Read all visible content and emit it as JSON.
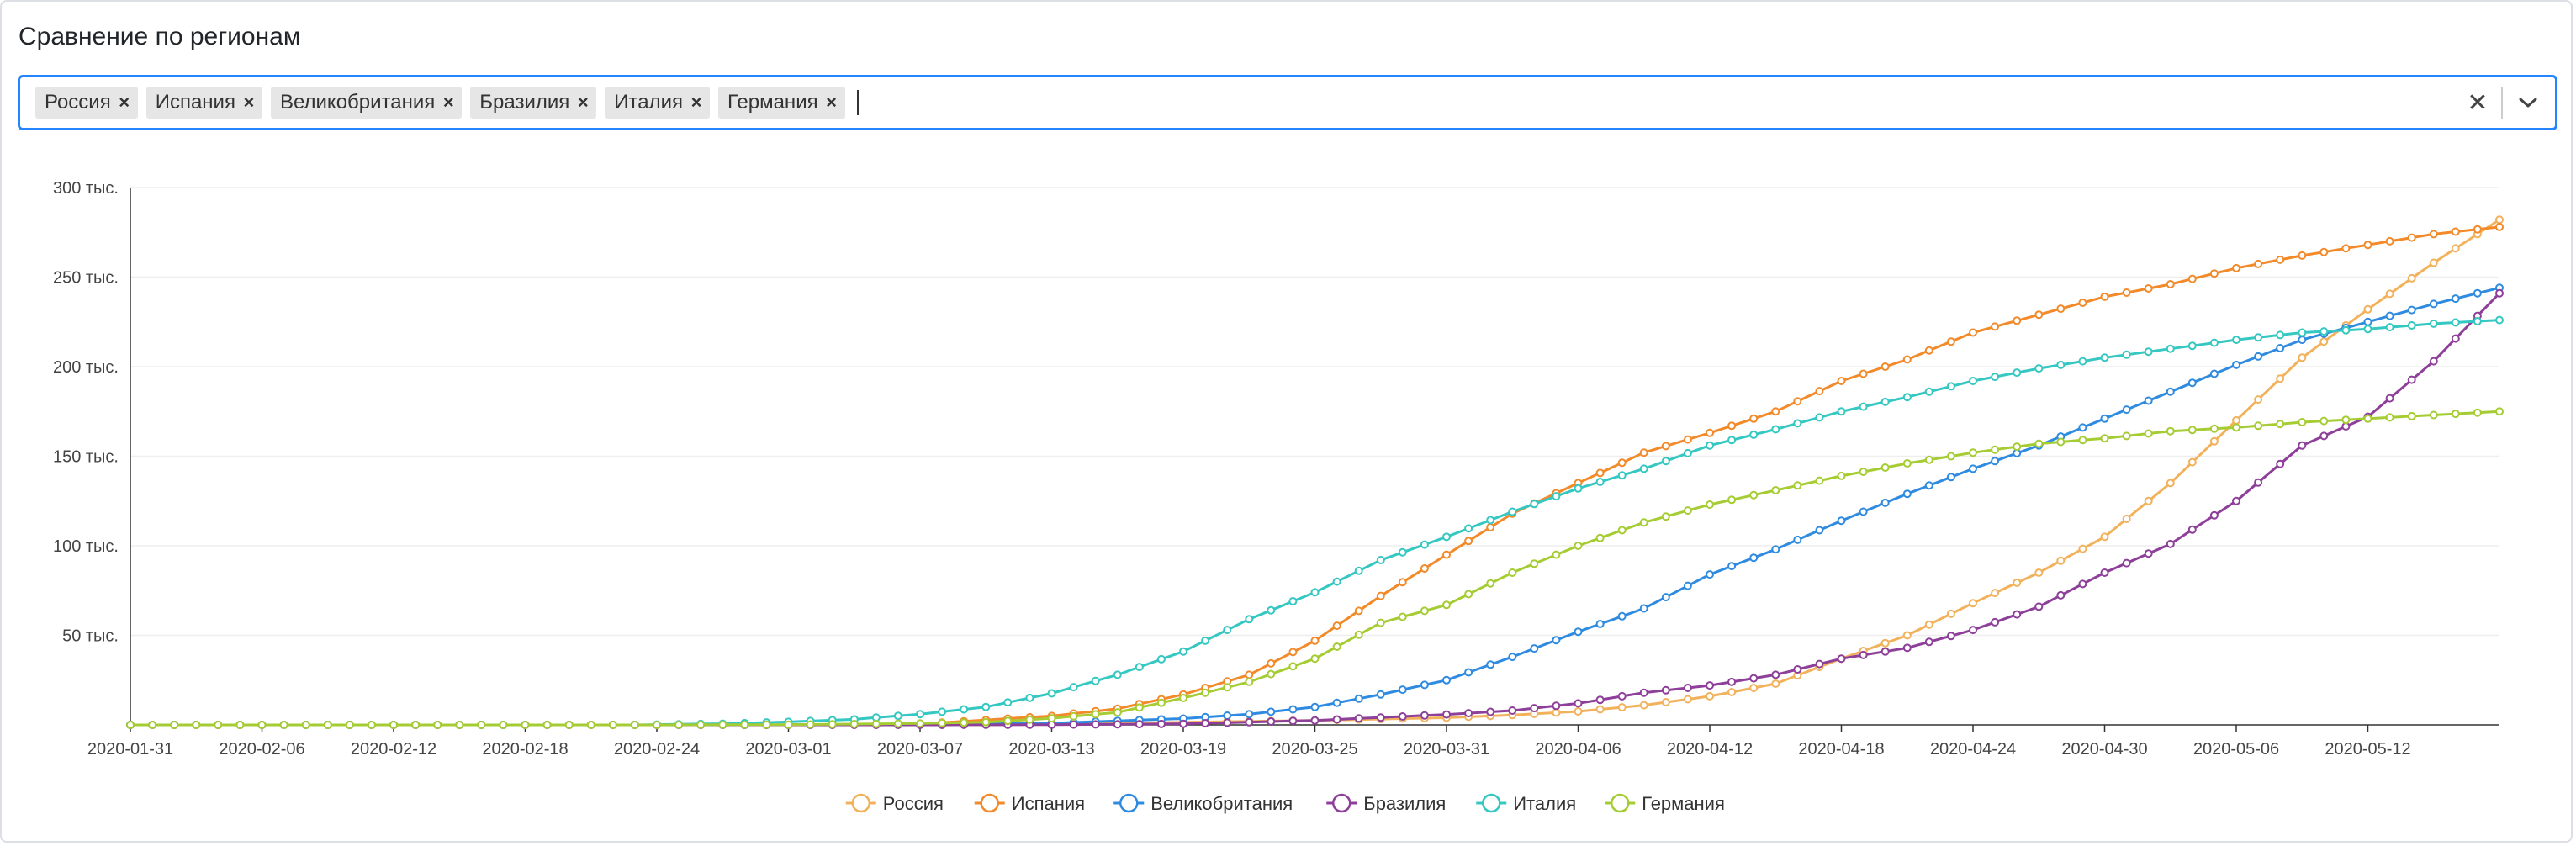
{
  "header": {
    "title": "Сравнение по регионам"
  },
  "selector": {
    "tags": [
      {
        "label": "Россия"
      },
      {
        "label": "Испания"
      },
      {
        "label": "Великобритания"
      },
      {
        "label": "Бразилия"
      },
      {
        "label": "Италия"
      },
      {
        "label": "Германия"
      }
    ],
    "remove_glyph": "×",
    "clear_glyph": "✕",
    "icons": {
      "clear": "close-icon",
      "dropdown": "chevron-down-icon",
      "tag_remove": "close-icon"
    }
  },
  "chart_data": {
    "type": "line",
    "title": "",
    "xlabel": "",
    "ylabel": "",
    "x_start": "2020-01-31",
    "x_end": "2020-05-18",
    "xticks": [
      "2020-01-31",
      "2020-02-06",
      "2020-02-12",
      "2020-02-18",
      "2020-02-24",
      "2020-03-01",
      "2020-03-07",
      "2020-03-13",
      "2020-03-19",
      "2020-03-25",
      "2020-03-31",
      "2020-04-06",
      "2020-04-12",
      "2020-04-18",
      "2020-04-24",
      "2020-04-30",
      "2020-05-06",
      "2020-05-12"
    ],
    "ylim": [
      0,
      300000
    ],
    "yticks": [
      {
        "value": 50000,
        "label": "50 тыс."
      },
      {
        "value": 100000,
        "label": "100 тыс."
      },
      {
        "value": 150000,
        "label": "150 тыс."
      },
      {
        "value": 200000,
        "label": "200 тыс."
      },
      {
        "value": 250000,
        "label": "250 тыс."
      },
      {
        "value": 300000,
        "label": "300 тыс."
      }
    ],
    "grid": true,
    "legend_position": "bottom",
    "series": [
      {
        "name": "Россия",
        "color": "#f2b25c",
        "points": [
          [
            "2020-03-01",
            0
          ],
          [
            "2020-03-13",
            500
          ],
          [
            "2020-03-19",
            1500
          ],
          [
            "2020-03-25",
            2500
          ],
          [
            "2020-03-31",
            4000
          ],
          [
            "2020-04-03",
            5500
          ],
          [
            "2020-04-06",
            7500
          ],
          [
            "2020-04-09",
            11000
          ],
          [
            "2020-04-12",
            16000
          ],
          [
            "2020-04-15",
            23000
          ],
          [
            "2020-04-18",
            37000
          ],
          [
            "2020-04-21",
            50000
          ],
          [
            "2020-04-24",
            68000
          ],
          [
            "2020-04-27",
            85000
          ],
          [
            "2020-04-30",
            105000
          ],
          [
            "2020-05-03",
            135000
          ],
          [
            "2020-05-06",
            170000
          ],
          [
            "2020-05-09",
            205000
          ],
          [
            "2020-05-12",
            232000
          ],
          [
            "2020-05-15",
            258000
          ],
          [
            "2020-05-18",
            282000
          ]
        ]
      },
      {
        "name": "Испания",
        "color": "#f28a2a",
        "points": [
          [
            "2020-03-01",
            100
          ],
          [
            "2020-03-07",
            500
          ],
          [
            "2020-03-13",
            5000
          ],
          [
            "2020-03-16",
            9000
          ],
          [
            "2020-03-19",
            17000
          ],
          [
            "2020-03-22",
            28000
          ],
          [
            "2020-03-25",
            47000
          ],
          [
            "2020-03-28",
            72000
          ],
          [
            "2020-03-31",
            95000
          ],
          [
            "2020-04-03",
            118000
          ],
          [
            "2020-04-06",
            135000
          ],
          [
            "2020-04-09",
            152000
          ],
          [
            "2020-04-12",
            163000
          ],
          [
            "2020-04-15",
            175000
          ],
          [
            "2020-04-18",
            192000
          ],
          [
            "2020-04-21",
            204000
          ],
          [
            "2020-04-24",
            219000
          ],
          [
            "2020-04-27",
            229000
          ],
          [
            "2020-04-30",
            239000
          ],
          [
            "2020-05-03",
            246000
          ],
          [
            "2020-05-06",
            255000
          ],
          [
            "2020-05-09",
            262000
          ],
          [
            "2020-05-12",
            268000
          ],
          [
            "2020-05-15",
            274000
          ],
          [
            "2020-05-18",
            278000
          ]
        ]
      },
      {
        "name": "Великобритания",
        "color": "#2f8be0",
        "points": [
          [
            "2020-03-01",
            50
          ],
          [
            "2020-03-13",
            1000
          ],
          [
            "2020-03-19",
            3500
          ],
          [
            "2020-03-22",
            6000
          ],
          [
            "2020-03-25",
            10000
          ],
          [
            "2020-03-28",
            17000
          ],
          [
            "2020-03-31",
            25000
          ],
          [
            "2020-04-03",
            38000
          ],
          [
            "2020-04-06",
            52000
          ],
          [
            "2020-04-09",
            65000
          ],
          [
            "2020-04-12",
            84000
          ],
          [
            "2020-04-15",
            98000
          ],
          [
            "2020-04-18",
            114000
          ],
          [
            "2020-04-21",
            129000
          ],
          [
            "2020-04-24",
            143000
          ],
          [
            "2020-04-27",
            156000
          ],
          [
            "2020-04-30",
            171000
          ],
          [
            "2020-05-03",
            186000
          ],
          [
            "2020-05-06",
            201000
          ],
          [
            "2020-05-09",
            215000
          ],
          [
            "2020-05-12",
            225000
          ],
          [
            "2020-05-15",
            235000
          ],
          [
            "2020-05-18",
            244000
          ]
        ]
      },
      {
        "name": "Бразилия",
        "color": "#8e3f99",
        "points": [
          [
            "2020-03-07",
            0
          ],
          [
            "2020-03-13",
            100
          ],
          [
            "2020-03-19",
            600
          ],
          [
            "2020-03-25",
            2500
          ],
          [
            "2020-03-31",
            5800
          ],
          [
            "2020-04-03",
            8000
          ],
          [
            "2020-04-06",
            12000
          ],
          [
            "2020-04-09",
            18000
          ],
          [
            "2020-04-12",
            22000
          ],
          [
            "2020-04-15",
            28000
          ],
          [
            "2020-04-18",
            37000
          ],
          [
            "2020-04-21",
            43000
          ],
          [
            "2020-04-24",
            53000
          ],
          [
            "2020-04-27",
            66000
          ],
          [
            "2020-04-30",
            85000
          ],
          [
            "2020-05-03",
            101000
          ],
          [
            "2020-05-06",
            125000
          ],
          [
            "2020-05-09",
            156000
          ],
          [
            "2020-05-12",
            172000
          ],
          [
            "2020-05-15",
            203000
          ],
          [
            "2020-05-18",
            241000
          ]
        ]
      },
      {
        "name": "Италия",
        "color": "#35c7c1",
        "points": [
          [
            "2020-02-24",
            200
          ],
          [
            "2020-02-27",
            650
          ],
          [
            "2020-03-01",
            1700
          ],
          [
            "2020-03-04",
            3100
          ],
          [
            "2020-03-07",
            6000
          ],
          [
            "2020-03-10",
            10000
          ],
          [
            "2020-03-13",
            17600
          ],
          [
            "2020-03-16",
            28000
          ],
          [
            "2020-03-19",
            41000
          ],
          [
            "2020-03-22",
            59000
          ],
          [
            "2020-03-25",
            74000
          ],
          [
            "2020-03-28",
            92000
          ],
          [
            "2020-03-31",
            105000
          ],
          [
            "2020-04-03",
            119000
          ],
          [
            "2020-04-06",
            132000
          ],
          [
            "2020-04-09",
            143000
          ],
          [
            "2020-04-12",
            156000
          ],
          [
            "2020-04-15",
            165000
          ],
          [
            "2020-04-18",
            175000
          ],
          [
            "2020-04-21",
            183000
          ],
          [
            "2020-04-24",
            192000
          ],
          [
            "2020-04-27",
            199000
          ],
          [
            "2020-04-30",
            205000
          ],
          [
            "2020-05-03",
            210000
          ],
          [
            "2020-05-06",
            215000
          ],
          [
            "2020-05-09",
            219000
          ],
          [
            "2020-05-12",
            221000
          ],
          [
            "2020-05-15",
            224000
          ],
          [
            "2020-05-18",
            226000
          ]
        ]
      },
      {
        "name": "Германия",
        "color": "#a6cc33",
        "points": [
          [
            "2020-02-24",
            16
          ],
          [
            "2020-03-01",
            130
          ],
          [
            "2020-03-07",
            800
          ],
          [
            "2020-03-10",
            1500
          ],
          [
            "2020-03-13",
            3700
          ],
          [
            "2020-03-16",
            7000
          ],
          [
            "2020-03-19",
            15000
          ],
          [
            "2020-03-22",
            24000
          ],
          [
            "2020-03-25",
            37000
          ],
          [
            "2020-03-28",
            57000
          ],
          [
            "2020-03-31",
            67000
          ],
          [
            "2020-04-03",
            85000
          ],
          [
            "2020-04-06",
            100000
          ],
          [
            "2020-04-09",
            113000
          ],
          [
            "2020-04-12",
            123000
          ],
          [
            "2020-04-15",
            131000
          ],
          [
            "2020-04-18",
            139000
          ],
          [
            "2020-04-21",
            146000
          ],
          [
            "2020-04-24",
            152000
          ],
          [
            "2020-04-27",
            157000
          ],
          [
            "2020-04-30",
            160000
          ],
          [
            "2020-05-03",
            164000
          ],
          [
            "2020-05-06",
            166000
          ],
          [
            "2020-05-09",
            169000
          ],
          [
            "2020-05-12",
            171000
          ],
          [
            "2020-05-15",
            173000
          ],
          [
            "2020-05-18",
            175000
          ]
        ]
      }
    ]
  }
}
